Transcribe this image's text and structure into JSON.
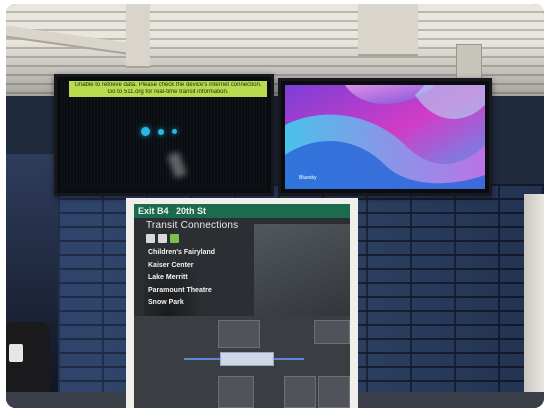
{
  "left_monitor": {
    "banner_line_1": "Unable to retrieve data. Please check the device's internet connection.",
    "banner_line_2": "Go to 511.org for real-time transit information.",
    "banner_color": "#b9db50",
    "loading_dot_color": "#28b8e8"
  },
  "right_monitor": {
    "caption": "Bluesky"
  },
  "poster": {
    "station_header": "20th St",
    "exit_label": "Exit B4",
    "title": "Transit Connections",
    "destinations": [
      "Children's Fairyland",
      "Kaiser Center",
      "Lake Merritt",
      "Paramount Theatre",
      "Snow Park"
    ],
    "header_color": "#1c6b4e"
  }
}
